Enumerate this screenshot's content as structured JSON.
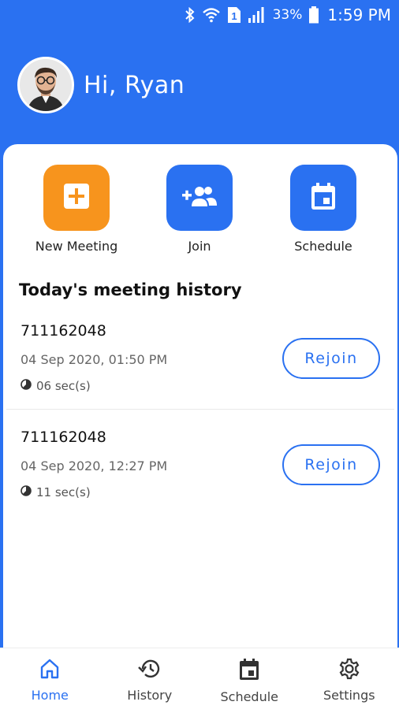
{
  "status_bar": {
    "battery": "33%",
    "time": "1:59 PM",
    "sim_slot": "1",
    "icons": [
      "bluetooth-icon",
      "wifi-icon",
      "sim-icon",
      "signal-icon",
      "battery-icon"
    ]
  },
  "header": {
    "greeting": "Hi, Ryan",
    "avatar": "avatar-photo"
  },
  "actions": [
    {
      "label": "New Meeting",
      "icon": "new-meeting-icon",
      "color": "#f7941d"
    },
    {
      "label": "Join",
      "icon": "join-icon",
      "color": "#2a71f1"
    },
    {
      "label": "Schedule",
      "icon": "schedule-icon",
      "color": "#2a71f1"
    }
  ],
  "history": {
    "title": "Today's meeting history",
    "items": [
      {
        "id": "711162048",
        "time": "04 Sep 2020, 01:50 PM",
        "duration": "06 sec(s)",
        "button": "Rejoin"
      },
      {
        "id": "711162048",
        "time": "04 Sep 2020, 12:27 PM",
        "duration": "11 sec(s)",
        "button": "Rejoin"
      }
    ]
  },
  "bottom_nav": {
    "items": [
      {
        "label": "Home",
        "icon": "home-icon",
        "active": true
      },
      {
        "label": "History",
        "icon": "history-icon",
        "active": false
      },
      {
        "label": "Schedule",
        "icon": "calendar-icon",
        "active": false
      },
      {
        "label": "Settings",
        "icon": "gear-icon",
        "active": false
      }
    ]
  },
  "colors": {
    "primary": "#2a71f1",
    "accent": "#f7941d",
    "active_nav": "#2a71f1"
  }
}
